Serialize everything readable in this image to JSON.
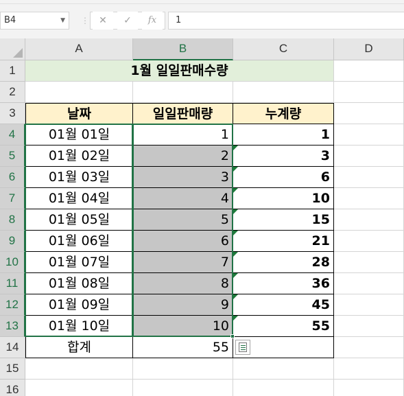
{
  "formula_bar": {
    "name_box": "B4",
    "cancel_icon": "✕",
    "enter_icon": "✓",
    "function_icon": "fx",
    "content": "1"
  },
  "columns": [
    "A",
    "B",
    "C",
    "D"
  ],
  "rows": [
    "1",
    "2",
    "3",
    "4",
    "5",
    "6",
    "7",
    "8",
    "9",
    "10",
    "11",
    "12",
    "13",
    "14",
    "15",
    "16"
  ],
  "sheet": {
    "title": "1월 일일판매수량",
    "headers": [
      "날짜",
      "일일판매량",
      "누계량"
    ],
    "data": [
      {
        "date": "01월 01일",
        "daily": "1",
        "cumulative": "1"
      },
      {
        "date": "01월 02일",
        "daily": "2",
        "cumulative": "3"
      },
      {
        "date": "01월 03일",
        "daily": "3",
        "cumulative": "6"
      },
      {
        "date": "01월 04일",
        "daily": "4",
        "cumulative": "10"
      },
      {
        "date": "01월 05일",
        "daily": "5",
        "cumulative": "15"
      },
      {
        "date": "01월 06일",
        "daily": "6",
        "cumulative": "21"
      },
      {
        "date": "01월 07일",
        "daily": "7",
        "cumulative": "28"
      },
      {
        "date": "01월 08일",
        "daily": "8",
        "cumulative": "36"
      },
      {
        "date": "01월 09일",
        "daily": "9",
        "cumulative": "45"
      },
      {
        "date": "01월 10일",
        "daily": "10",
        "cumulative": "55"
      }
    ],
    "total_label": "합계",
    "total_value": "55"
  },
  "colors": {
    "accent": "#217346",
    "header_fill": "#fff2cc",
    "title_fill": "#e2efda",
    "selection_fill": "#c6c6c6"
  },
  "icons": {
    "quick_analysis": "quick-analysis-icon",
    "error_indicator": "green-triangle-icon"
  }
}
